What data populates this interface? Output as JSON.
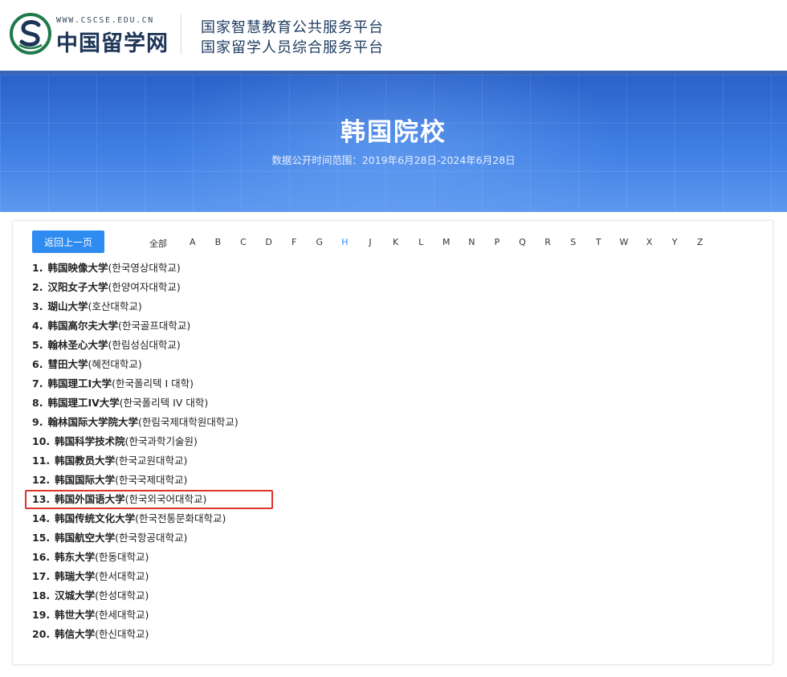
{
  "header": {
    "logo_url": "WWW.CSCSE.EDU.CN",
    "logo_name": "中国留学网",
    "platform_line1": "国家智慧教育公共服务平台",
    "platform_line2": "国家留学人员综合服务平台"
  },
  "banner": {
    "title": "韩国院校",
    "subtitle": "数据公开时间范围：2019年6月28日-2024年6月28日"
  },
  "toolbar": {
    "back_label": "返回上一页"
  },
  "letter_filter": {
    "all_label": "全部",
    "letters": [
      "A",
      "B",
      "C",
      "D",
      "F",
      "G",
      "H",
      "J",
      "K",
      "L",
      "M",
      "N",
      "P",
      "Q",
      "R",
      "S",
      "T",
      "W",
      "X",
      "Y",
      "Z"
    ],
    "active": "H"
  },
  "universities": [
    {
      "num": "1.",
      "name": "韩国映像大学",
      "korean": "(한국영상대학교)"
    },
    {
      "num": "2.",
      "name": "汉阳女子大学",
      "korean": "(한양여자대학교)"
    },
    {
      "num": "3.",
      "name": "瑚山大学",
      "korean": "(호산대학교)"
    },
    {
      "num": "4.",
      "name": "韩国高尔夫大学",
      "korean": "(한국골프대학교)"
    },
    {
      "num": "5.",
      "name": "翰林圣心大学",
      "korean": "(한림성심대학교)"
    },
    {
      "num": "6.",
      "name": "彗田大学",
      "korean": "(혜전대학교)"
    },
    {
      "num": "7.",
      "name": "韩国理工I大学",
      "korean": "(한국폴리텍 I 대학)"
    },
    {
      "num": "8.",
      "name": "韩国理工IV大学",
      "korean": "(한국폴리텍 IV 대학)"
    },
    {
      "num": "9.",
      "name": "翰林国际大学院大学",
      "korean": "(한림국제대학원대학교)"
    },
    {
      "num": "10.",
      "name": "韩国科学技术院",
      "korean": "(한국과학기술원)"
    },
    {
      "num": "11.",
      "name": "韩国教员大学",
      "korean": "(한국교원대학교)"
    },
    {
      "num": "12.",
      "name": "韩国国际大学",
      "korean": "(한국국제대학교)"
    },
    {
      "num": "13.",
      "name": "韩国外国语大学",
      "korean": "(한국외국어대학교)"
    },
    {
      "num": "14.",
      "name": "韩国传统文化大学",
      "korean": "(한국전통문화대학교)"
    },
    {
      "num": "15.",
      "name": "韩国航空大学",
      "korean": "(한국항공대학교)"
    },
    {
      "num": "16.",
      "name": "韩东大学",
      "korean": "(한동대학교)"
    },
    {
      "num": "17.",
      "name": "韩瑞大学",
      "korean": "(한서대학교)"
    },
    {
      "num": "18.",
      "name": "汉城大学",
      "korean": "(한성대학교)"
    },
    {
      "num": "19.",
      "name": "韩世大学",
      "korean": "(한세대학교)"
    },
    {
      "num": "20.",
      "name": "韩信大学",
      "korean": "(한신대학교)"
    }
  ],
  "colors": {
    "accent": "#2e8bef",
    "highlight": "#e0312b",
    "banner": "#3f7fe4"
  }
}
